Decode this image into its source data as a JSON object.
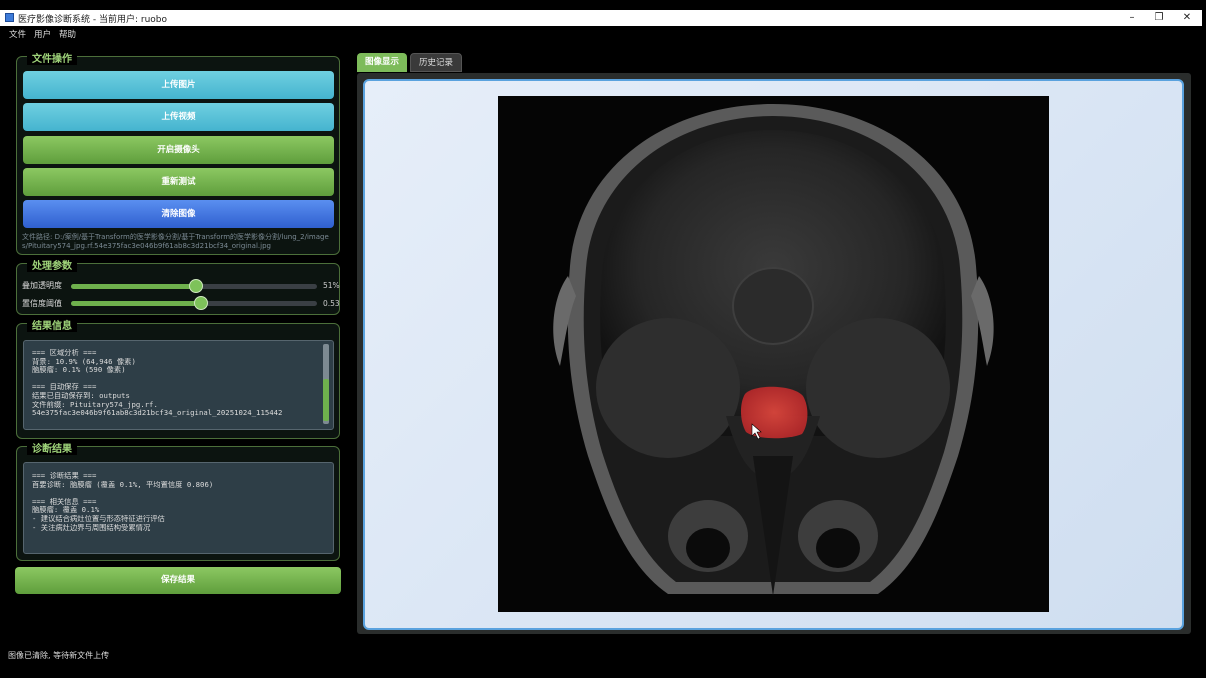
{
  "window": {
    "title": "医疗影像诊断系统 - 当前用户: ruobo",
    "minimize": "–",
    "maximize": "❐",
    "close": "✕"
  },
  "menu": [
    "文件",
    "用户",
    "帮助"
  ],
  "file_panel": {
    "title": "文件操作",
    "buttons": [
      "上传图片",
      "上传视频",
      "开启摄像头",
      "重新测试",
      "清除图像"
    ],
    "file_path": "文件路径: D:/案例/基于Transform的医学影像分割/基于Transform的医学影像分割/lung_2/images/Pituitary574_jpg.rf.54e375fac3e046b9f61ab8c3d21bcf34_original.jpg"
  },
  "params_panel": {
    "title": "处理参数",
    "overlay_label": "叠加透明度",
    "overlay_value": "51%",
    "overlay_fraction": 0.51,
    "confidence_label": "置信度阈值",
    "confidence_value": "0.53",
    "confidence_fraction": 0.53
  },
  "results_panel": {
    "title": "结果信息",
    "lines": [
      "=== 区域分析 ===",
      "背景: 10.9% (64,946 像素)",
      "脑膜瘤: 0.1% (590 像素)",
      "",
      "=== 自动保存 ===",
      "结果已自动保存到: outputs",
      "文件前缀: Pituitary574_jpg.rf.",
      "54e375fac3e046b9f61ab8c3d21bcf34_original_20251024_115442"
    ]
  },
  "diagnosis_panel": {
    "title": "诊断结果",
    "lines": [
      "=== 诊断结果 ===",
      "首要诊断: 脑膜瘤 (覆盖 0.1%, 平均置信度 0.806)",
      "",
      "=== 相关信息 ===",
      "脑膜瘤: 覆盖 0.1%",
      "- 建议结合病灶位置与形态特征进行评估",
      "- 关注病灶边界与周围结构受累情况"
    ]
  },
  "save_button": "保存结果",
  "tabs": [
    "图像显示",
    "历史记录"
  ],
  "status": "图像已清除, 等待新文件上传",
  "colors": {
    "accent_green": "#7dbb5a",
    "accent_cyan": "#45b4cf",
    "accent_blue": "#2f5fcf",
    "view_border": "#5aa2de",
    "lesion": "#d93b32"
  }
}
